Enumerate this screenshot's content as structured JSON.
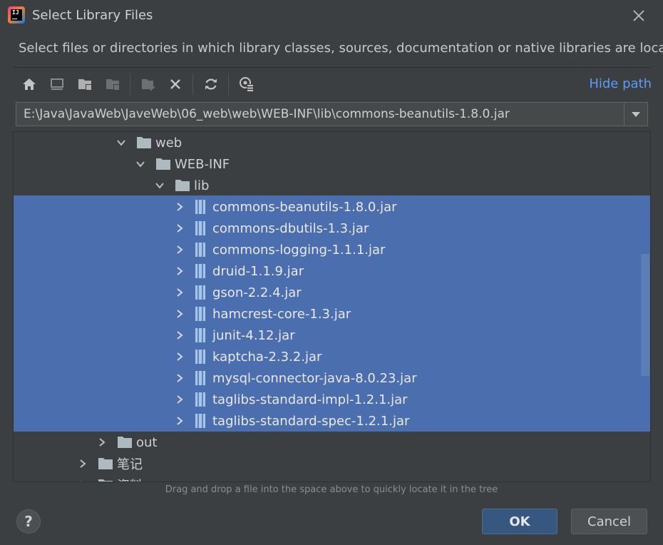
{
  "window": {
    "title": "Select Library Files"
  },
  "description": "Select files or directories in which library classes, sources, documentation or native libraries are located",
  "toolbar": {
    "buttons": [
      "home-icon",
      "desktop-icon",
      "project-folder-icon",
      "module-folder-icon",
      "new-folder-icon",
      "delete-icon",
      "refresh-icon",
      "show-hidden-icon"
    ],
    "hide_path_label": "Hide path"
  },
  "path": {
    "value": "E:\\Java\\JavaWeb\\JaveWeb\\06_web\\web\\WEB-INF\\lib\\commons-beanutils-1.8.0.jar"
  },
  "tree": {
    "folders": {
      "web": "web",
      "webinf": "WEB-INF",
      "lib": "lib",
      "out": "out",
      "notes": "笔记",
      "partial": "资料"
    },
    "jars": [
      "commons-beanutils-1.8.0.jar",
      "commons-dbutils-1.3.jar",
      "commons-logging-1.1.1.jar",
      "druid-1.1.9.jar",
      "gson-2.2.4.jar",
      "hamcrest-core-1.3.jar",
      "junit-4.12.jar",
      "kaptcha-2.3.2.jar",
      "mysql-connector-java-8.0.23.jar",
      "taglibs-standard-impl-1.2.1.jar",
      "taglibs-standard-spec-1.2.1.jar"
    ]
  },
  "hint": "Drag and drop a file into the space above to quickly locate it in the tree",
  "buttons": {
    "help": "?",
    "ok": "OK",
    "cancel": "Cancel"
  },
  "colors": {
    "accent": "#4b6eaf",
    "link": "#589df6",
    "primary_button": "#365880",
    "background": "#3c3f41"
  }
}
